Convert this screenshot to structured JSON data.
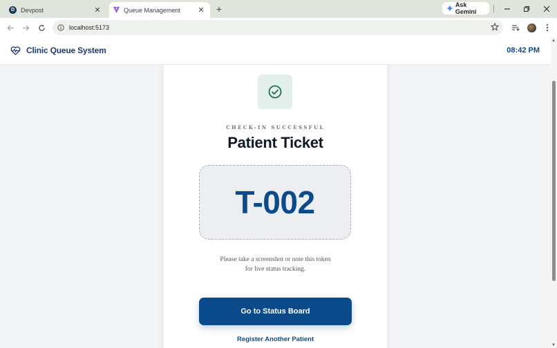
{
  "browser": {
    "tabs": [
      {
        "title": "Devpost",
        "favicon_letter": "D"
      },
      {
        "title": "Queue Management"
      }
    ],
    "ask_gemini_label": "Ask Gemini",
    "url": "localhost:5173"
  },
  "app": {
    "brand_name": "Clinic Queue System",
    "time": "08:42 PM"
  },
  "ticket": {
    "eyebrow": "CHECK-IN SUCCESSFUL",
    "title": "Patient Ticket",
    "token": "T-002",
    "note_line1": "Please take a screenshot or note this token",
    "note_line2": "for live status tracking.",
    "primary_action": "Go to Status Board",
    "secondary_action": "Register Another Patient"
  },
  "colors": {
    "brand_blue": "#0b4a8b",
    "success_bg": "#e3efea",
    "success_icon": "#1f6a5a"
  }
}
